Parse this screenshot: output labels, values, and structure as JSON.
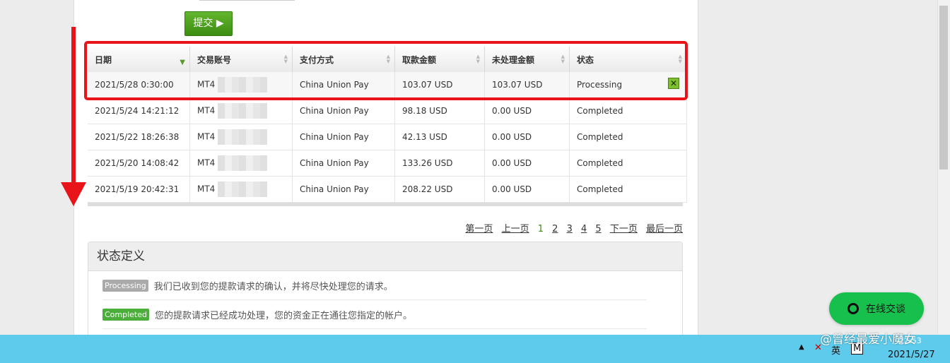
{
  "form": {
    "submit_label": "提交 ▶"
  },
  "table": {
    "headers": [
      "日期",
      "交易账号",
      "支付方式",
      "取款金额",
      "未处理金额",
      "状态"
    ],
    "rows": [
      {
        "date": "2021/5/28 0:30:00",
        "account": "MT4",
        "method": "China Union Pay",
        "amount": "103.07 USD",
        "pending": "103.07 USD",
        "status": "Processing"
      },
      {
        "date": "2021/5/24 14:21:12",
        "account": "MT4",
        "method": "China Union Pay",
        "amount": "98.18 USD",
        "pending": "0.00 USD",
        "status": "Completed"
      },
      {
        "date": "2021/5/22 18:26:38",
        "account": "MT4",
        "method": "China Union Pay",
        "amount": "42.13 USD",
        "pending": "0.00 USD",
        "status": "Completed"
      },
      {
        "date": "2021/5/20 14:08:42",
        "account": "MT4",
        "method": "China Union Pay",
        "amount": "133.26 USD",
        "pending": "0.00 USD",
        "status": "Completed"
      },
      {
        "date": "2021/5/19 20:42:31",
        "account": "MT4",
        "method": "China Union Pay",
        "amount": "208.22 USD",
        "pending": "0.00 USD",
        "status": "Completed"
      }
    ],
    "cancel_icon": "close-icon"
  },
  "pagination": {
    "first": "第一页",
    "prev": "上一页",
    "pages": [
      "1",
      "2",
      "3",
      "4",
      "5"
    ],
    "current": "1",
    "next": "下一页",
    "last": "最后一页"
  },
  "definitions": {
    "title": "状态定义",
    "items": [
      {
        "badge": "Processing",
        "text": "我们已收到您的提款请求的确认，并将尽快处理您的请求。"
      },
      {
        "badge": "Completed",
        "text": "您的提款请求已经成功处理，您的资金正在通往您指定的帐户。"
      }
    ]
  },
  "chat": {
    "label": "在线交谈"
  },
  "taskbar": {
    "ime": "英",
    "ime2": "M",
    "date": "2021/5/27",
    "time": "22:53"
  },
  "watermark": "@曾经最爱小魔女",
  "colors": {
    "accent_green": "#3d8e12",
    "annotation_red": "#e8141a",
    "taskbar": "#5ecbed",
    "chat": "#17c04c"
  }
}
